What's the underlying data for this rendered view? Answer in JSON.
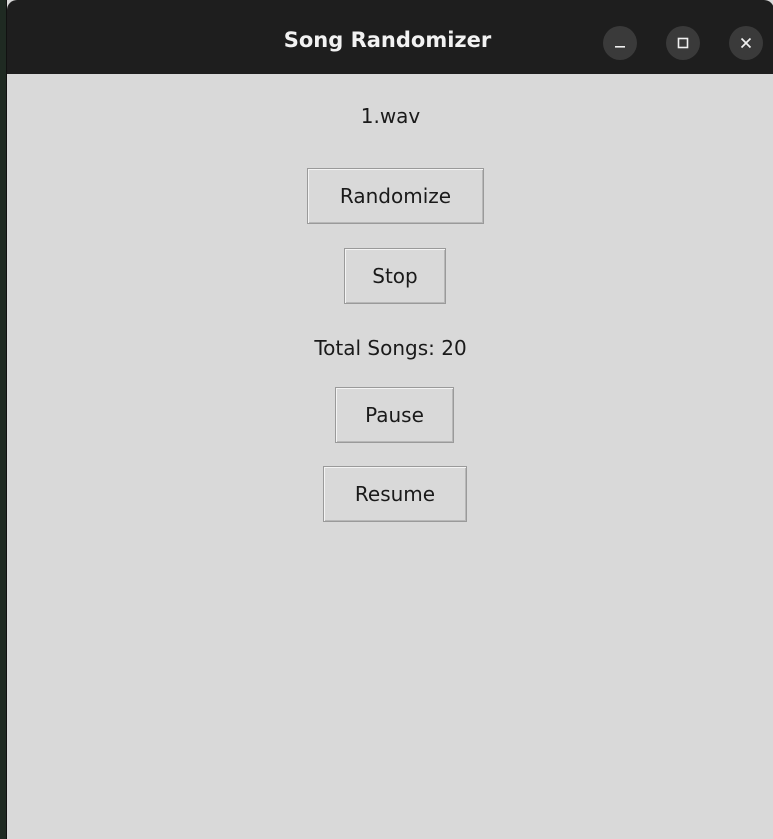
{
  "window": {
    "title": "Song Randomizer",
    "controls": {
      "minimize_icon": "minimize-icon",
      "maximize_icon": "maximize-icon",
      "close_icon": "close-icon"
    }
  },
  "player": {
    "current_song": "1.wav",
    "randomize_label": "Randomize",
    "stop_label": "Stop",
    "total_songs_text": "Total Songs: 20",
    "pause_label": "Pause",
    "resume_label": "Resume"
  },
  "colors": {
    "titlebar": "#1e1e1e",
    "window_bg": "#d9d9d9",
    "control_circle": "#3a3a3a"
  }
}
